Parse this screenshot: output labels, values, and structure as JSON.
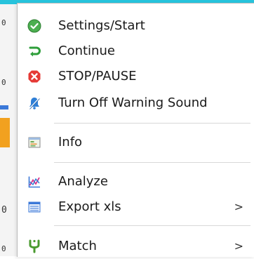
{
  "background": {
    "edge_chars": [
      "0",
      "0",
      "0",
      "0"
    ]
  },
  "menu": {
    "items": [
      {
        "label": "Settings/Start",
        "icon": "check-circle-icon",
        "color": "#4caf50"
      },
      {
        "label": "Continue",
        "icon": "continue-arrow-icon",
        "color": "#2e9e3a"
      },
      {
        "label": "STOP/PAUSE",
        "icon": "stop-x-icon",
        "color": "#e53935"
      },
      {
        "label": "Turn Off Warning Sound",
        "icon": "bell-mute-icon",
        "color": "#2f7fd6"
      },
      {
        "label": "Info",
        "icon": "info-window-icon",
        "color": "#6aa84f"
      },
      {
        "label": "Analyze",
        "icon": "analyze-chart-icon",
        "color": "#d6338a"
      },
      {
        "label": "Export xls",
        "icon": "export-list-icon",
        "color": "#3b78d8",
        "submenu": true
      },
      {
        "label": "Match",
        "icon": "match-fork-icon",
        "color": "#4a9a2f",
        "submenu": true
      }
    ],
    "submenu_arrow": ">"
  }
}
